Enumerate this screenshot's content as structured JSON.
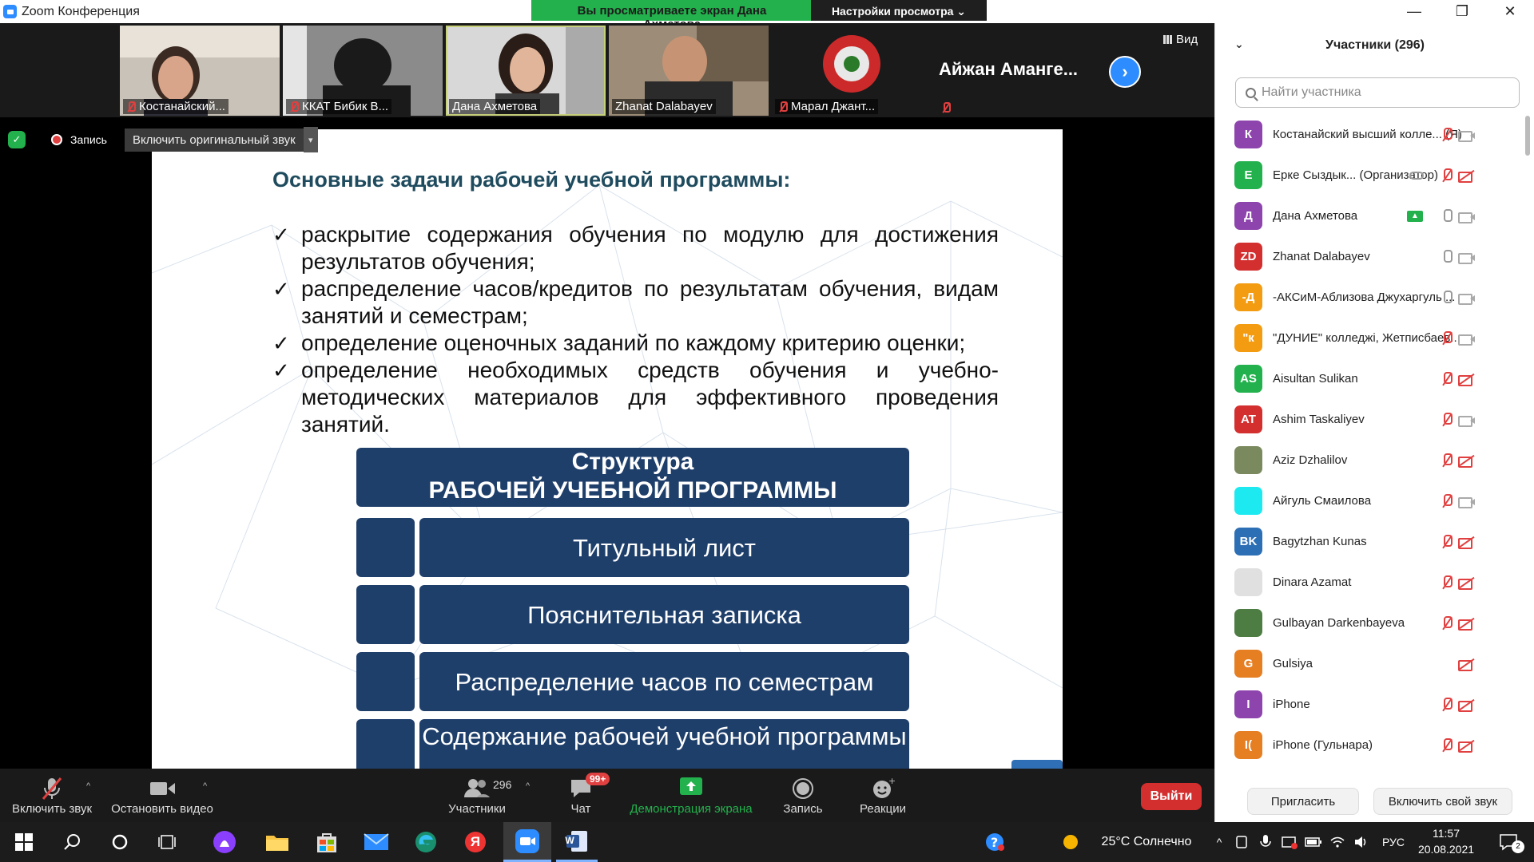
{
  "window": {
    "title": "Zoom Конференция",
    "share_banner": "Вы просматриваете экран Дана Ахметова",
    "view_options": "Настройки просмотра ⌄",
    "minimize": "—",
    "restore": "❐",
    "close": "✕"
  },
  "videos": {
    "tiles": [
      {
        "name": "Костанайский..."
      },
      {
        "name": "ККАТ Бибик В..."
      },
      {
        "name": "Дана Ахметова"
      },
      {
        "name": "Zhanat Dalabayev"
      },
      {
        "name": "Марал Джант..."
      }
    ],
    "text_tile": "Айжан  Аманге...",
    "next": "›",
    "view": "Вид"
  },
  "share": {
    "recording": "Запись",
    "original_sound": "Включить оригинальный звук",
    "caret": "▾"
  },
  "slide": {
    "title": "Основные задачи рабочей учебной программы:",
    "tasks": [
      "раскрытие содержания обучения по модулю для достижения результатов обучения;",
      "распределение часов/кредитов по результатам обучения, видам занятий и семестрам;",
      "определение оценочных заданий по каждому критерию оценки;",
      "определение необходимых средств обучения и учебно-методических материалов для эффективного проведения занятий."
    ],
    "structure_line1": "Структура",
    "structure_line2": "РАБОЧЕЙ УЧЕБНОЙ ПРОГРАММЫ",
    "items": [
      "Титульный лист",
      "Пояснительная записка",
      "Распределение часов по семестрам",
      "Содержание рабочей учебной программы"
    ]
  },
  "toolbar": {
    "unmute": "Включить звук",
    "stop_video": "Остановить видео",
    "participants": "Участники",
    "participants_count": "296",
    "chat": "Чат",
    "chat_badge": "99+",
    "share_screen": "Демонстрация экрана",
    "record": "Запись",
    "reactions": "Реакции",
    "leave": "Выйти",
    "caret": "^"
  },
  "panel": {
    "title": "Участники (296)",
    "collapse": "⌄",
    "search_placeholder": "Найти участника",
    "participants": [
      {
        "initials": "К",
        "name": "Костанайский высший колле... (Я)",
        "color": "#8e44ad",
        "mic": "off",
        "cam": "on"
      },
      {
        "initials": "Е",
        "name": "Ерке Сыздык... (Организатор)",
        "color": "#23b14d",
        "mic": "off",
        "cam": "off"
      },
      {
        "initials": "Д",
        "name": "Дана Ахметова",
        "color": "#8e44ad",
        "mic": "on",
        "cam": "on"
      },
      {
        "initials": "ZD",
        "name": "Zhanat Dalabayev",
        "color": "#d32f2f",
        "mic": "on",
        "cam": "on"
      },
      {
        "initials": "-Д",
        "name": "-АКСиМ-Аблизова Джухаргуль ...",
        "color": "#f39c12",
        "mic": "on",
        "cam": "on"
      },
      {
        "initials": "\"к",
        "name": "\"ДУНИЕ\" колледжі, Жетписбаев...",
        "color": "#f39c12",
        "mic": "off",
        "cam": "on"
      },
      {
        "initials": "AS",
        "name": "Aisultan Sulikan",
        "color": "#23b14d",
        "mic": "off",
        "cam": "off"
      },
      {
        "initials": "AT",
        "name": "Ashim Taskaliyev",
        "color": "#d32f2f",
        "mic": "off",
        "cam": "on"
      },
      {
        "initials": "",
        "name": "Aziz Dzhalilov",
        "color": "#7a8a5e",
        "mic": "off",
        "cam": "off"
      },
      {
        "initials": "",
        "name": "Айгуль Смаилова",
        "color": "#1de9f0",
        "mic": "off",
        "cam": "on"
      },
      {
        "initials": "BK",
        "name": "Bagytzhan Kunas",
        "color": "#2d6fb5",
        "mic": "off",
        "cam": "off"
      },
      {
        "initials": "",
        "name": "Dinara Azamat",
        "color": "#e0e0e0",
        "mic": "off",
        "cam": "off"
      },
      {
        "initials": "",
        "name": "Gulbayan Darkenbayeva",
        "color": "#4e7d43",
        "mic": "off",
        "cam": "off"
      },
      {
        "initials": "G",
        "name": "Gulsiya",
        "color": "#e67e22",
        "mic": "none",
        "cam": "off"
      },
      {
        "initials": "I",
        "name": "iPhone",
        "color": "#8e44ad",
        "mic": "off",
        "cam": "off"
      },
      {
        "initials": "I(",
        "name": "iPhone (Гульнара)",
        "color": "#e67e22",
        "mic": "off",
        "cam": "off"
      }
    ],
    "invite": "Пригласить",
    "unmute_me": "Включить свой звук"
  },
  "taskbar": {
    "weather": "25°C  Солнечно",
    "lang": "РУС",
    "time": "11:57",
    "date": "20.08.2021",
    "notifications": "2",
    "yandex": "Я",
    "word": "W"
  }
}
